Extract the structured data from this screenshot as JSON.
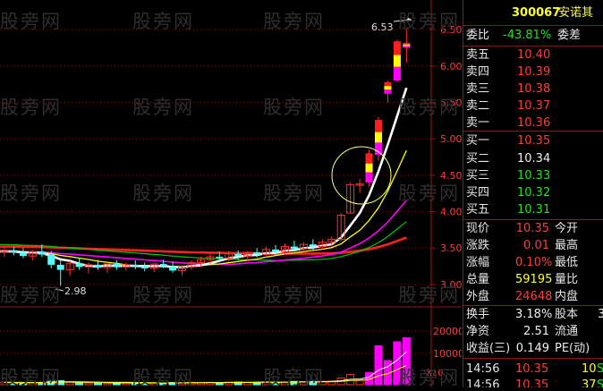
{
  "stock": {
    "code": "300067",
    "name": "安诺其"
  },
  "watermark": "股旁网",
  "weibi": {
    "label": "委比",
    "value": "-43.81%",
    "label2": "委差"
  },
  "sell": [
    {
      "label": "卖五",
      "price": "10.40"
    },
    {
      "label": "卖四",
      "price": "10.39"
    },
    {
      "label": "卖三",
      "price": "10.38"
    },
    {
      "label": "卖二",
      "price": "10.37"
    },
    {
      "label": "卖一",
      "price": "10.36"
    }
  ],
  "buy": [
    {
      "label": "买一",
      "price": "10.35"
    },
    {
      "label": "买二",
      "price": "10.34"
    },
    {
      "label": "买三",
      "price": "10.33"
    },
    {
      "label": "买四",
      "price": "10.32"
    },
    {
      "label": "买五",
      "price": "10.31"
    }
  ],
  "quote": [
    {
      "label": "现价",
      "value": "10.35",
      "label2": "今开"
    },
    {
      "label": "涨跌",
      "value": "0.01",
      "label2": "最高"
    },
    {
      "label": "涨幅",
      "value": "0.10%",
      "label2": "最低"
    },
    {
      "label": "总量",
      "value": "59195",
      "label2": "量比"
    },
    {
      "label": "外盘",
      "value": "24648",
      "label2": "内盘"
    }
  ],
  "fund": [
    {
      "label": "换手",
      "value": "3.18%",
      "label2": "股本",
      "extra": "3"
    },
    {
      "label": "净资",
      "value": "2.51",
      "label2": "流通",
      "extra": ""
    },
    {
      "label": "收益(三)",
      "value": "0.149",
      "label2": "PE(动)",
      "extra": ""
    }
  ],
  "ticks": [
    {
      "time": "14:56",
      "price": "10.35",
      "vol": "10",
      "flag": "S"
    },
    {
      "time": "14:56",
      "price": "10.35",
      "vol": "37",
      "flag": "S"
    }
  ],
  "price_axis": [
    "6.50",
    "6.00",
    "5.50",
    "5.00",
    "4.50",
    "4.00",
    "3.50",
    "3.00"
  ],
  "volume_axis": [
    "20000",
    "10000",
    "X10"
  ],
  "annotations": {
    "high": "6.53",
    "low": "2.98"
  },
  "colors": {
    "up": "#ff3030",
    "down": "#54ffff",
    "ma5": "#ffffff",
    "ma10": "#ffff00",
    "ma20": "#ff00ff",
    "ma30": "#00cc00",
    "ma60": "#ff2020"
  },
  "chart_data": {
    "type": "candlestick",
    "ylim": [
      2.9,
      6.6
    ],
    "candles": [
      {
        "o": 3.45,
        "h": 3.52,
        "l": 3.38,
        "c": 3.47
      },
      {
        "o": 3.47,
        "h": 3.52,
        "l": 3.4,
        "c": 3.44
      },
      {
        "o": 3.44,
        "h": 3.5,
        "l": 3.36,
        "c": 3.39
      },
      {
        "o": 3.39,
        "h": 3.47,
        "l": 3.33,
        "c": 3.45
      },
      {
        "o": 3.45,
        "h": 3.55,
        "l": 3.38,
        "c": 3.41
      },
      {
        "o": 3.41,
        "h": 3.46,
        "l": 3.22,
        "c": 3.27
      },
      {
        "o": 3.27,
        "h": 3.35,
        "l": 2.98,
        "c": 3.2
      },
      {
        "o": 3.2,
        "h": 3.32,
        "l": 3.12,
        "c": 3.29
      },
      {
        "o": 3.29,
        "h": 3.37,
        "l": 3.2,
        "c": 3.24
      },
      {
        "o": 3.24,
        "h": 3.3,
        "l": 3.15,
        "c": 3.27
      },
      {
        "o": 3.27,
        "h": 3.34,
        "l": 3.2,
        "c": 3.23
      },
      {
        "o": 3.23,
        "h": 3.31,
        "l": 3.16,
        "c": 3.28
      },
      {
        "o": 3.28,
        "h": 3.33,
        "l": 3.2,
        "c": 3.24
      },
      {
        "o": 3.24,
        "h": 3.3,
        "l": 3.19,
        "c": 3.27
      },
      {
        "o": 3.27,
        "h": 3.33,
        "l": 3.21,
        "c": 3.25
      },
      {
        "o": 3.25,
        "h": 3.3,
        "l": 3.18,
        "c": 3.22
      },
      {
        "o": 3.22,
        "h": 3.29,
        "l": 3.17,
        "c": 3.28
      },
      {
        "o": 3.28,
        "h": 3.34,
        "l": 3.22,
        "c": 3.25
      },
      {
        "o": 3.25,
        "h": 3.31,
        "l": 3.16,
        "c": 3.19
      },
      {
        "o": 3.19,
        "h": 3.26,
        "l": 3.12,
        "c": 3.24
      },
      {
        "o": 3.24,
        "h": 3.33,
        "l": 3.2,
        "c": 3.3
      },
      {
        "o": 3.3,
        "h": 3.38,
        "l": 3.24,
        "c": 3.34
      },
      {
        "o": 3.34,
        "h": 3.42,
        "l": 3.28,
        "c": 3.38
      },
      {
        "o": 3.38,
        "h": 3.45,
        "l": 3.3,
        "c": 3.36
      },
      {
        "o": 3.36,
        "h": 3.46,
        "l": 3.31,
        "c": 3.42
      },
      {
        "o": 3.42,
        "h": 3.47,
        "l": 3.34,
        "c": 3.39
      },
      {
        "o": 3.39,
        "h": 3.46,
        "l": 3.33,
        "c": 3.44
      },
      {
        "o": 3.44,
        "h": 3.5,
        "l": 3.37,
        "c": 3.41
      },
      {
        "o": 3.41,
        "h": 3.52,
        "l": 3.36,
        "c": 3.48
      },
      {
        "o": 3.48,
        "h": 3.54,
        "l": 3.4,
        "c": 3.45
      },
      {
        "o": 3.45,
        "h": 3.56,
        "l": 3.41,
        "c": 3.52
      },
      {
        "o": 3.52,
        "h": 3.6,
        "l": 3.45,
        "c": 3.49
      },
      {
        "o": 3.49,
        "h": 3.58,
        "l": 3.44,
        "c": 3.55
      },
      {
        "o": 3.55,
        "h": 3.62,
        "l": 3.47,
        "c": 3.52
      },
      {
        "o": 3.52,
        "h": 3.62,
        "l": 3.48,
        "c": 3.58
      },
      {
        "o": 3.58,
        "h": 3.66,
        "l": 3.52,
        "c": 3.62
      },
      {
        "o": 3.62,
        "h": 3.98,
        "l": 3.6,
        "c": 3.95
      },
      {
        "o": 3.98,
        "h": 4.4,
        "l": 3.98,
        "c": 4.37
      },
      {
        "o": 4.37,
        "h": 4.45,
        "l": 4.26,
        "c": 4.38
      },
      {
        "o": 4.4,
        "h": 4.85,
        "l": 4.34,
        "c": 4.8
      },
      {
        "o": 4.78,
        "h": 5.3,
        "l": 4.7,
        "c": 5.26
      },
      {
        "o": 5.62,
        "h": 5.8,
        "l": 5.5,
        "c": 5.78
      },
      {
        "o": 5.8,
        "h": 6.36,
        "l": 5.78,
        "c": 6.34
      },
      {
        "o": 6.25,
        "h": 6.53,
        "l": 6.05,
        "c": 6.32
      }
    ],
    "volumes": [
      900,
      700,
      800,
      650,
      900,
      1300,
      1500,
      1100,
      700,
      650,
      800,
      600,
      700,
      650,
      700,
      750,
      600,
      650,
      800,
      700,
      900,
      850,
      900,
      800,
      950,
      1000,
      850,
      900,
      1100,
      950,
      1000,
      1200,
      1100,
      1250,
      1300,
      1350,
      2500,
      3800,
      1800,
      4500,
      14500,
      9000,
      16000,
      17500
    ]
  }
}
